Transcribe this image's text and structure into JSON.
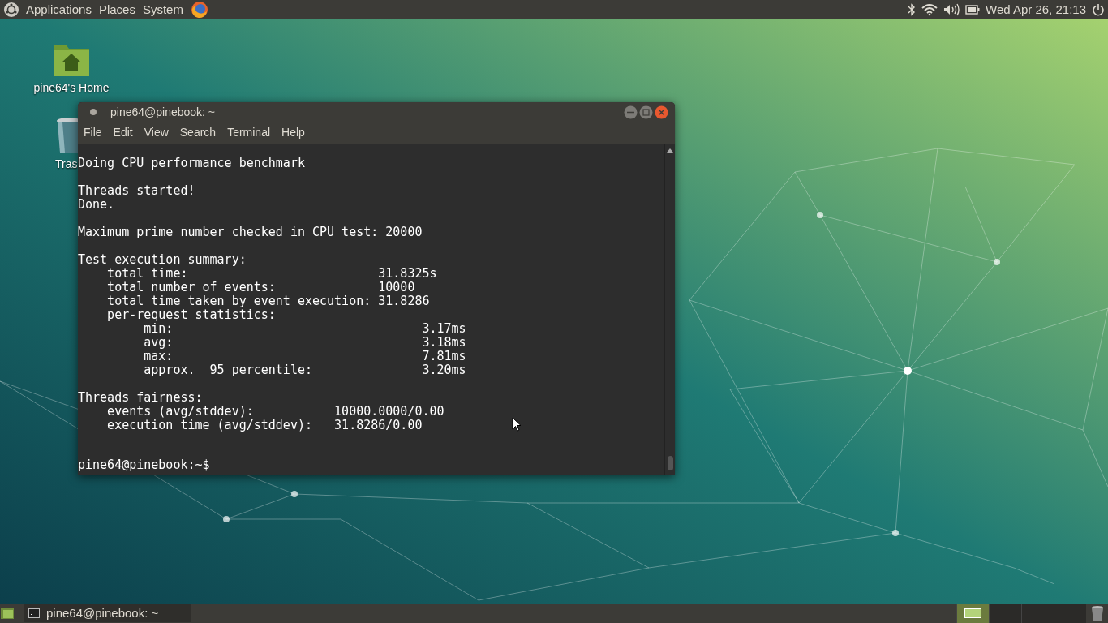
{
  "top_panel": {
    "menus": [
      "Applications",
      "Places",
      "System"
    ],
    "clock": "Wed Apr 26, 21:13"
  },
  "desktop_icons": [
    {
      "kind": "home",
      "label": "pine64's Home"
    },
    {
      "kind": "trash",
      "label": "Tras"
    }
  ],
  "terminal": {
    "title": "pine64@pinebook: ~",
    "menu": [
      "File",
      "Edit",
      "View",
      "Search",
      "Terminal",
      "Help"
    ],
    "blocks": [
      [
        "Doing CPU performance benchmark"
      ],
      [
        "Threads started!",
        "Done."
      ],
      [
        "Maximum prime number checked in CPU test: 20000"
      ],
      [
        "Test execution summary:",
        "    total time:                          31.8325s",
        "    total number of events:              10000",
        "    total time taken by event execution: 31.8286",
        "    per-request statistics:",
        "         min:                                  3.17ms",
        "         avg:                                  3.18ms",
        "         max:                                  7.81ms",
        "         approx.  95 percentile:               3.20ms"
      ],
      [
        "Threads fairness:",
        "    events (avg/stddev):           10000.0000/0.00",
        "    execution time (avg/stddev):   31.8286/0.00"
      ]
    ],
    "prompt": "pine64@pinebook:~$"
  },
  "taskbar": {
    "tasks": [
      {
        "label": "pine64@pinebook: ~"
      }
    ],
    "workspaces": [
      {
        "selected": true
      },
      {
        "selected": false
      },
      {
        "selected": false
      },
      {
        "selected": false
      }
    ]
  }
}
